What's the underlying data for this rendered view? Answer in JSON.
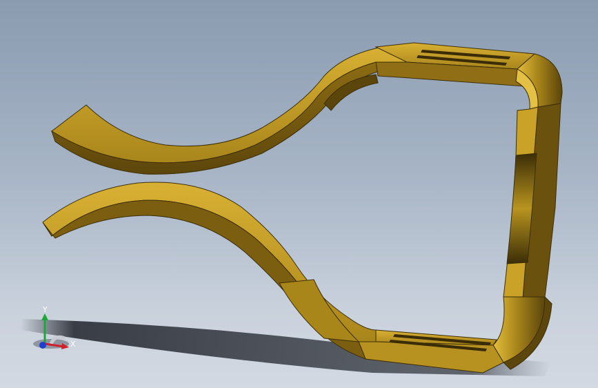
{
  "viewport": {
    "background_top": "#8a9bb0",
    "background_bottom": "#d3d9e2"
  },
  "model": {
    "name": "spring-clip",
    "color_light": "#c9a227",
    "color_mid": "#a8861a",
    "color_dark": "#6e5410",
    "color_edge": "#3d2e07"
  },
  "triad": {
    "x_label": "X",
    "y_label": "Y",
    "x_color": "#d0202a",
    "y_color": "#1fa53a",
    "z_color": "#1f3fd0"
  }
}
